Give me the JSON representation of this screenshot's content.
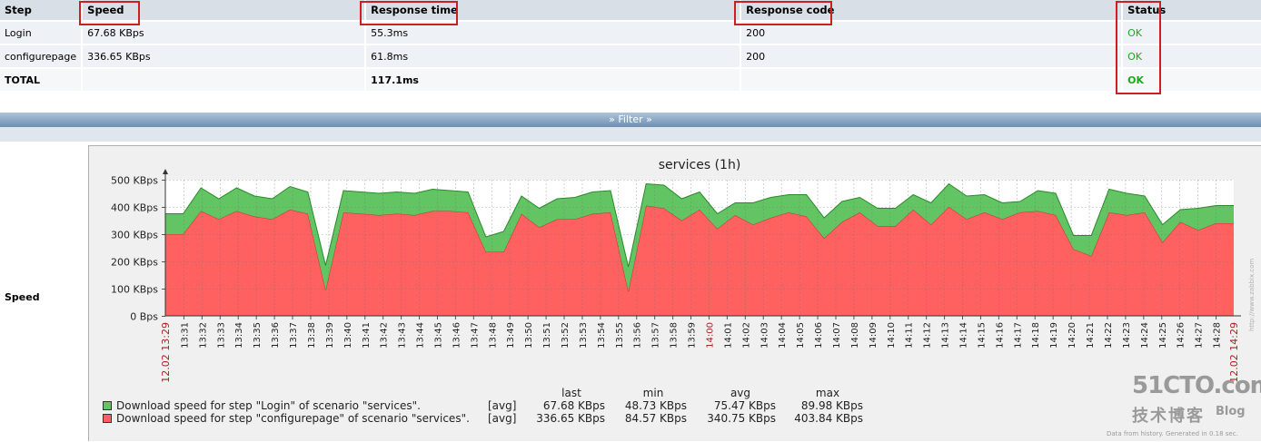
{
  "table": {
    "headers": [
      "Step",
      "Speed",
      "Response time",
      "Response code",
      "Status"
    ],
    "rows": [
      {
        "step": "Login",
        "speed": "67.68 KBps",
        "response_time": "55.3ms",
        "response_code": "200",
        "status": "OK"
      },
      {
        "step": "configurepage",
        "speed": "336.65 KBps",
        "response_time": "61.8ms",
        "response_code": "200",
        "status": "OK"
      }
    ],
    "total": {
      "step": "TOTAL",
      "speed": "",
      "response_time": "117.1ms",
      "response_code": "",
      "status": "OK"
    }
  },
  "filter": {
    "label": "Filter",
    "icon": "double-chevron-down-icon"
  },
  "graph_row_label": "Speed",
  "chart_data": {
    "type": "area",
    "title": "services (1h)",
    "ylim": [
      0,
      500
    ],
    "y_ticks": [
      "0 Bps",
      "100 KBps",
      "200 KBps",
      "300 KBps",
      "400 KBps",
      "500 KBps"
    ],
    "x_start_label": "12.02 13:29",
    "x_end_label": "12.02 14:29",
    "x_ticks": [
      "13:31",
      "13:32",
      "13:33",
      "13:34",
      "13:35",
      "13:36",
      "13:37",
      "13:38",
      "13:39",
      "13:40",
      "13:41",
      "13:42",
      "13:43",
      "13:44",
      "13:45",
      "13:46",
      "13:47",
      "13:48",
      "13:49",
      "13:50",
      "13:51",
      "13:52",
      "13:53",
      "13:54",
      "13:55",
      "13:56",
      "13:57",
      "13:58",
      "13:59",
      "14:00",
      "14:01",
      "14:02",
      "14:03",
      "14:04",
      "14:05",
      "14:06",
      "14:07",
      "14:08",
      "14:09",
      "14:10",
      "14:11",
      "14:12",
      "14:13",
      "14:14",
      "14:15",
      "14:16",
      "14:17",
      "14:18",
      "14:19",
      "14:20",
      "14:21",
      "14:22",
      "14:23",
      "14:24",
      "14:25",
      "14:26",
      "14:27",
      "14:28"
    ],
    "highlight_ticks": [
      "14:00"
    ],
    "stacked": true,
    "grid": true,
    "series": [
      {
        "name": "Download speed for step \"configurepage\" of scenario \"services\".",
        "color": "#ff6060",
        "values": [
          300,
          300,
          385,
          355,
          385,
          365,
          355,
          390,
          375,
          95,
          380,
          375,
          370,
          375,
          370,
          385,
          385,
          380,
          235,
          235,
          375,
          325,
          355,
          355,
          375,
          380,
          90,
          405,
          395,
          350,
          390,
          320,
          370,
          335,
          360,
          380,
          365,
          285,
          345,
          380,
          330,
          330,
          390,
          335,
          400,
          355,
          380,
          355,
          380,
          385,
          370,
          245,
          220,
          380,
          370,
          380,
          270,
          345,
          315,
          340,
          340
        ]
      },
      {
        "name": "Download speed for step \"Login\" of scenario \"services\".",
        "color": "#62c462",
        "values": [
          75,
          75,
          85,
          75,
          85,
          75,
          75,
          85,
          80,
          90,
          80,
          80,
          80,
          80,
          80,
          80,
          75,
          75,
          55,
          75,
          65,
          70,
          75,
          80,
          80,
          80,
          90,
          80,
          85,
          80,
          65,
          55,
          45,
          80,
          75,
          65,
          80,
          75,
          75,
          55,
          65,
          65,
          55,
          80,
          85,
          85,
          65,
          60,
          40,
          75,
          80,
          50,
          75,
          85,
          80,
          60,
          65,
          45,
          80,
          65,
          65
        ]
      }
    ]
  },
  "legend": {
    "headers": [
      "last",
      "min",
      "avg",
      "max"
    ],
    "items": [
      {
        "color": "#62c462",
        "label": "Download speed for step \"Login\" of scenario \"services\".",
        "func": "[avg]",
        "last": "67.68 KBps",
        "min": "48.73 KBps",
        "avg": "75.47 KBps",
        "max": "89.98 KBps"
      },
      {
        "color": "#ff6060",
        "label": "Download speed for step \"configurepage\" of scenario \"services\".",
        "func": "[avg]",
        "last": "336.65 KBps",
        "min": "84.57 KBps",
        "avg": "340.75 KBps",
        "max": "403.84 KBps"
      }
    ]
  },
  "watermark": {
    "main": "51CTO.com",
    "cn": "技术博客",
    "blog": "Blog",
    "generated": "Data from history. Generated in 0.18 sec.",
    "url": "http://www.zabbix.com"
  }
}
